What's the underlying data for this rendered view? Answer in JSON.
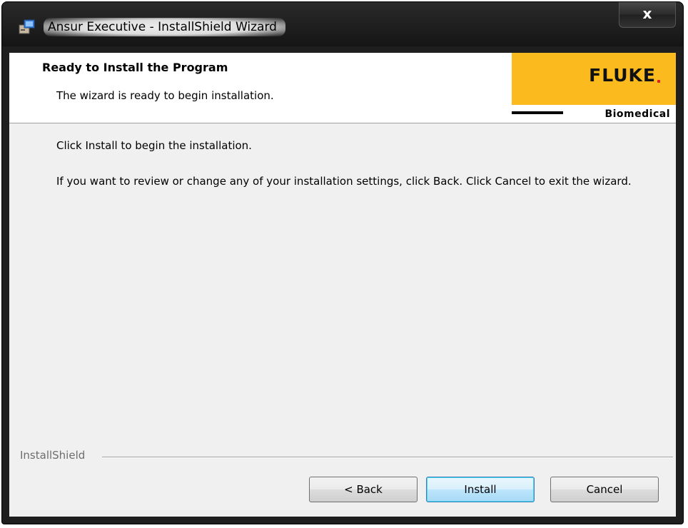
{
  "window": {
    "title": "Ansur Executive - InstallShield Wizard",
    "close_label": "x"
  },
  "header": {
    "title": "Ready to Install the Program",
    "subtitle": "The wizard is ready to begin installation.",
    "logo": {
      "brand": "FLUKE",
      "tagline": "Biomedical",
      "accent_color": "#fbba1d"
    }
  },
  "body": {
    "line1": "Click Install to begin the installation.",
    "line2": "If you want to review or change any of your installation settings, click Back. Click Cancel to exit the wizard."
  },
  "footer": {
    "group_label": "InstallShield",
    "buttons": {
      "back": "< Back",
      "install": "Install",
      "cancel": "Cancel"
    }
  },
  "icons": {
    "app": "installer-icon",
    "close": "close-icon"
  }
}
